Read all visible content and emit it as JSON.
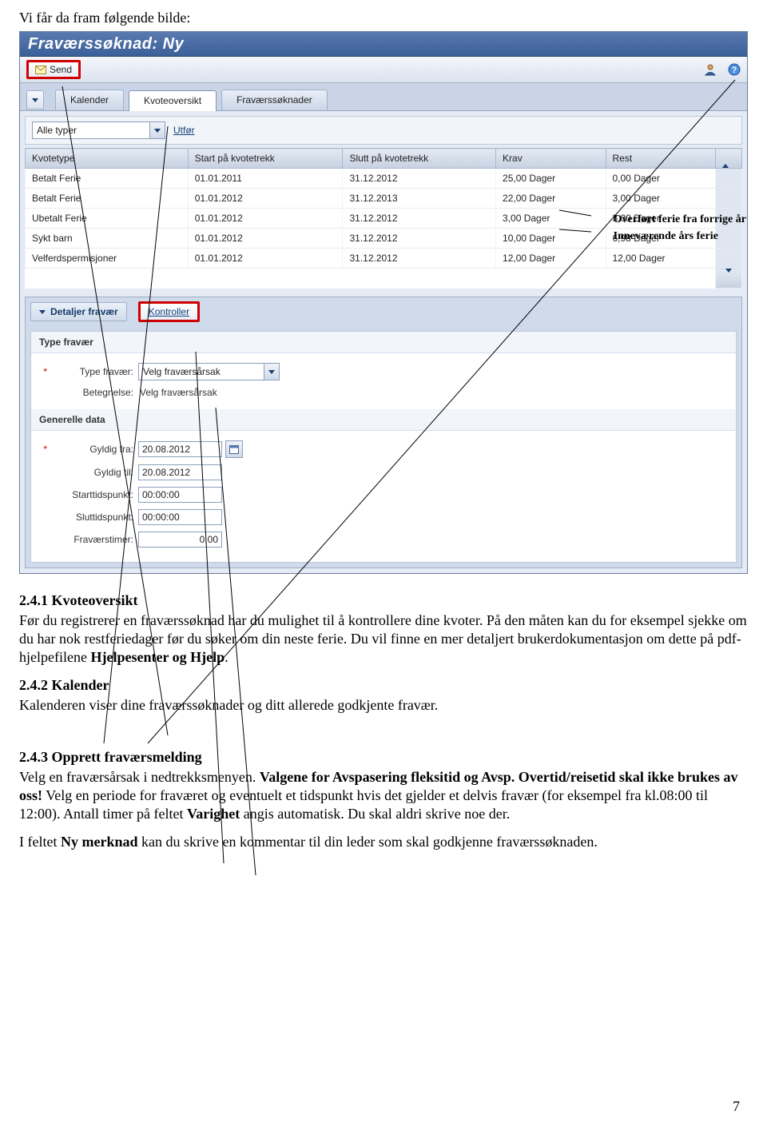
{
  "intro": "Vi får da fram følgende bilde:",
  "app": {
    "title": "Fraværssøknad: Ny",
    "send_label": "Send",
    "tabs": [
      "Kalender",
      "Kvoteoversikt",
      "Fraværssøknader"
    ],
    "active_tab": 1,
    "filter": {
      "value": "Alle typer",
      "action": "Utfør"
    },
    "grid": {
      "headers": [
        "Kvotetype",
        "Start på kvotetrekk",
        "Slutt på kvotetrekk",
        "Krav",
        "Rest"
      ],
      "rows": [
        [
          "Betalt Ferie",
          "01.01.2011",
          "31.12.2012",
          "25,00 Dager",
          "0,00 Dager"
        ],
        [
          "Betalt Ferie",
          "01.01.2012",
          "31.12.2013",
          "22,00 Dager",
          "3,00 Dager"
        ],
        [
          "Ubetalt Ferie",
          "01.01.2012",
          "31.12.2012",
          "3,00 Dager",
          "3,00 Dager"
        ],
        [
          "Sykt barn",
          "01.01.2012",
          "31.12.2012",
          "10,00 Dager",
          "6,98 Dager"
        ],
        [
          "Velferdspermisjoner",
          "01.01.2012",
          "31.12.2012",
          "12,00 Dager",
          "12,00 Dager"
        ]
      ]
    },
    "section": {
      "title": "Detaljer fravær",
      "kontroller": "Kontroller"
    },
    "form": {
      "group1": "Type fravær",
      "type_label": "Type fravær:",
      "type_value": "Velg fraværsårsak",
      "betegnelse_label": "Betegnelse:",
      "betegnelse_value": "Velg fraværsårsak",
      "group2": "Generelle data",
      "fra_label": "Gyldig fra:",
      "fra_value": "20.08.2012",
      "til_label": "Gyldig til:",
      "til_value": "20.08.2012",
      "start_label": "Starttidspunkt:",
      "start_value": "00:00:00",
      "slutt_label": "Sluttidspunkt:",
      "slutt_value": "00:00:00",
      "timer_label": "Fraværstimer:",
      "timer_value": "0,00"
    }
  },
  "annotations": {
    "line1": "Overført ferie fra forrige år",
    "line2": "Inneværende års ferie"
  },
  "doc": {
    "h241": "2.4.1 Kvoteoversikt",
    "p241a": "Før du registrerer en fraværssøknad har du mulighet til å kontrollere dine kvoter. På den måten kan du for eksempel sjekke om du har nok restferiedager før du søker om din neste ferie. Du vil finne en mer detaljert brukerdokumentasjon om dette på pdf-hjelpefilene ",
    "p241b": "Hjelpesenter og Hjelp",
    "p241c": ".",
    "h242": "2.4.2 Kalender",
    "p242": "Kalenderen viser dine fraværssøknader og ditt allerede godkjente fravær.",
    "h243": "2.4.3 Opprett fraværsmelding",
    "p243a": "Velg en fraværsårsak i nedtrekksmenyen. ",
    "p243b": "Valgene for Avspasering fleksitid og Avsp. Overtid/reisetid skal ikke brukes av oss!",
    "p243c": " Velg en periode for fraværet og eventuelt et tidspunkt hvis det gjelder et delvis fravær (for eksempel fra kl.08:00 til 12:00). Antall timer på feltet ",
    "p243d": "Varighet",
    "p243e": " angis automatisk. Du skal aldri skrive noe der.",
    "p244a": "I feltet ",
    "p244b": "Ny merknad",
    "p244c": " kan du skrive en kommentar til din leder som skal godkjenne fraværssøknaden."
  },
  "page_number": "7"
}
